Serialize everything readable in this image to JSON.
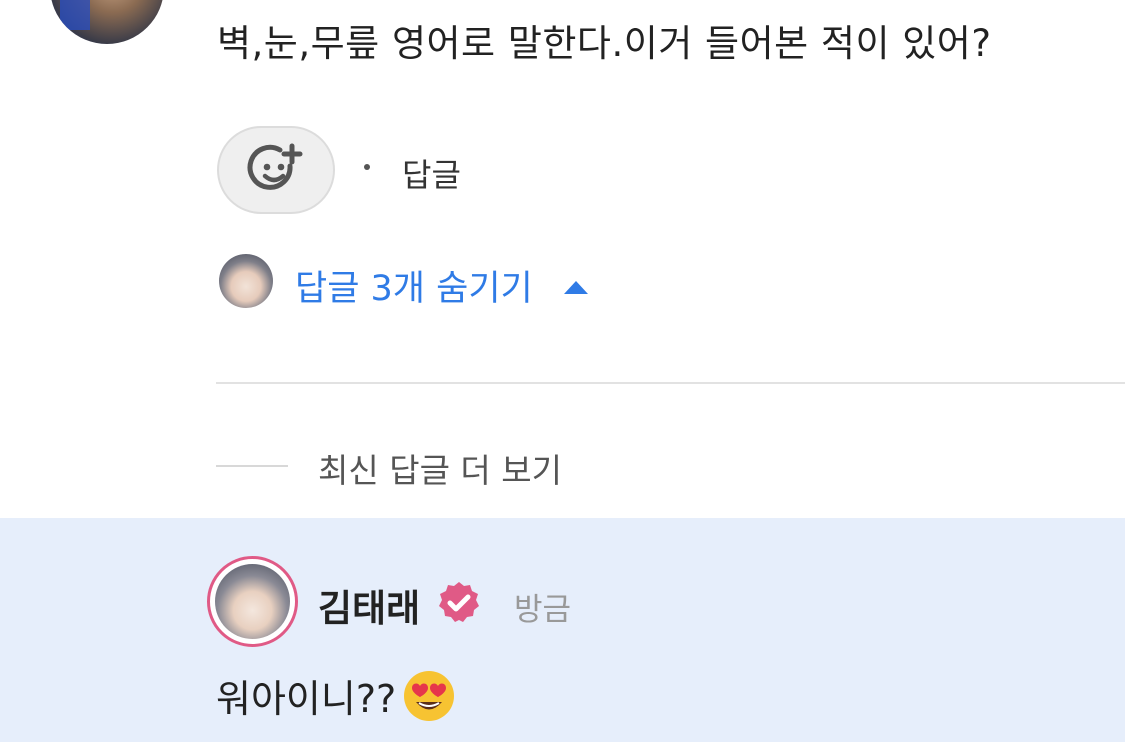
{
  "comment": {
    "text": "벽,눈,무릎 영어로 말한다.이거 들어본 적이 있어?",
    "reply_label": "답글",
    "reaction_button_icon": "smile-plus-icon",
    "hide_replies_label": "답글 3개 숨기기",
    "hide_replies_icon": "caret-up-icon"
  },
  "thread": {
    "more_replies_label": "최신 답글 더 보기"
  },
  "reply": {
    "author": "김태래",
    "verified_icon": "verified-badge-icon",
    "time": "방금",
    "text": "워아이니??",
    "emoji_icon": "heart-eyes-emoji"
  },
  "colors": {
    "accent_blue": "#2f7be6",
    "reply_background": "#e6eefb",
    "verified_pink": "#e05a86"
  }
}
